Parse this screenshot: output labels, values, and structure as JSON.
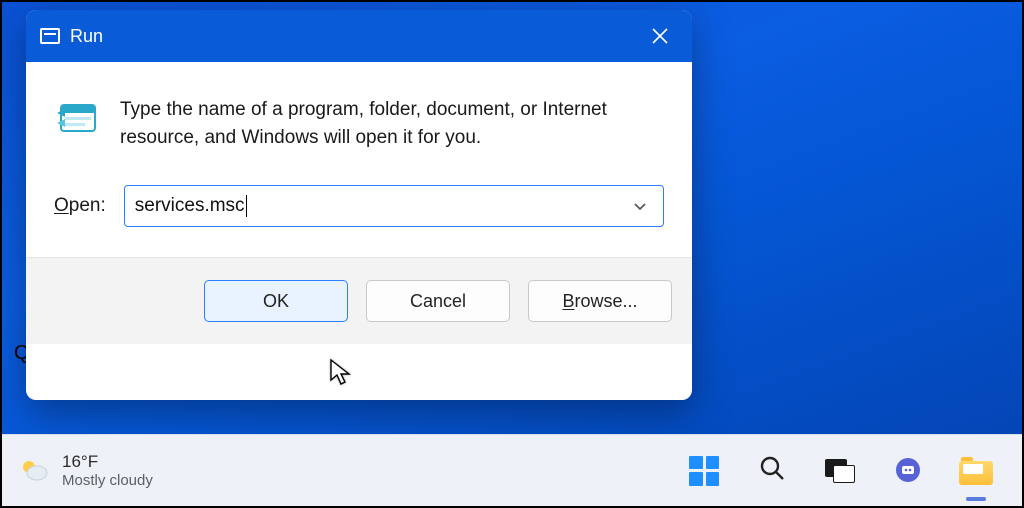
{
  "run_dialog": {
    "title": "Run",
    "description": "Type the name of a program, folder, document, or Internet resource, and Windows will open it for you.",
    "open_label_pre": "O",
    "open_label_post": "pen:",
    "input_value": "services.msc",
    "buttons": {
      "ok": "OK",
      "cancel": "Cancel",
      "browse_prefix": "B",
      "browse_suffix": "rowse..."
    }
  },
  "taskbar": {
    "weather": {
      "temp": "16°F",
      "condition": "Mostly cloudy"
    }
  },
  "misc": {
    "stray_char": "Q"
  }
}
